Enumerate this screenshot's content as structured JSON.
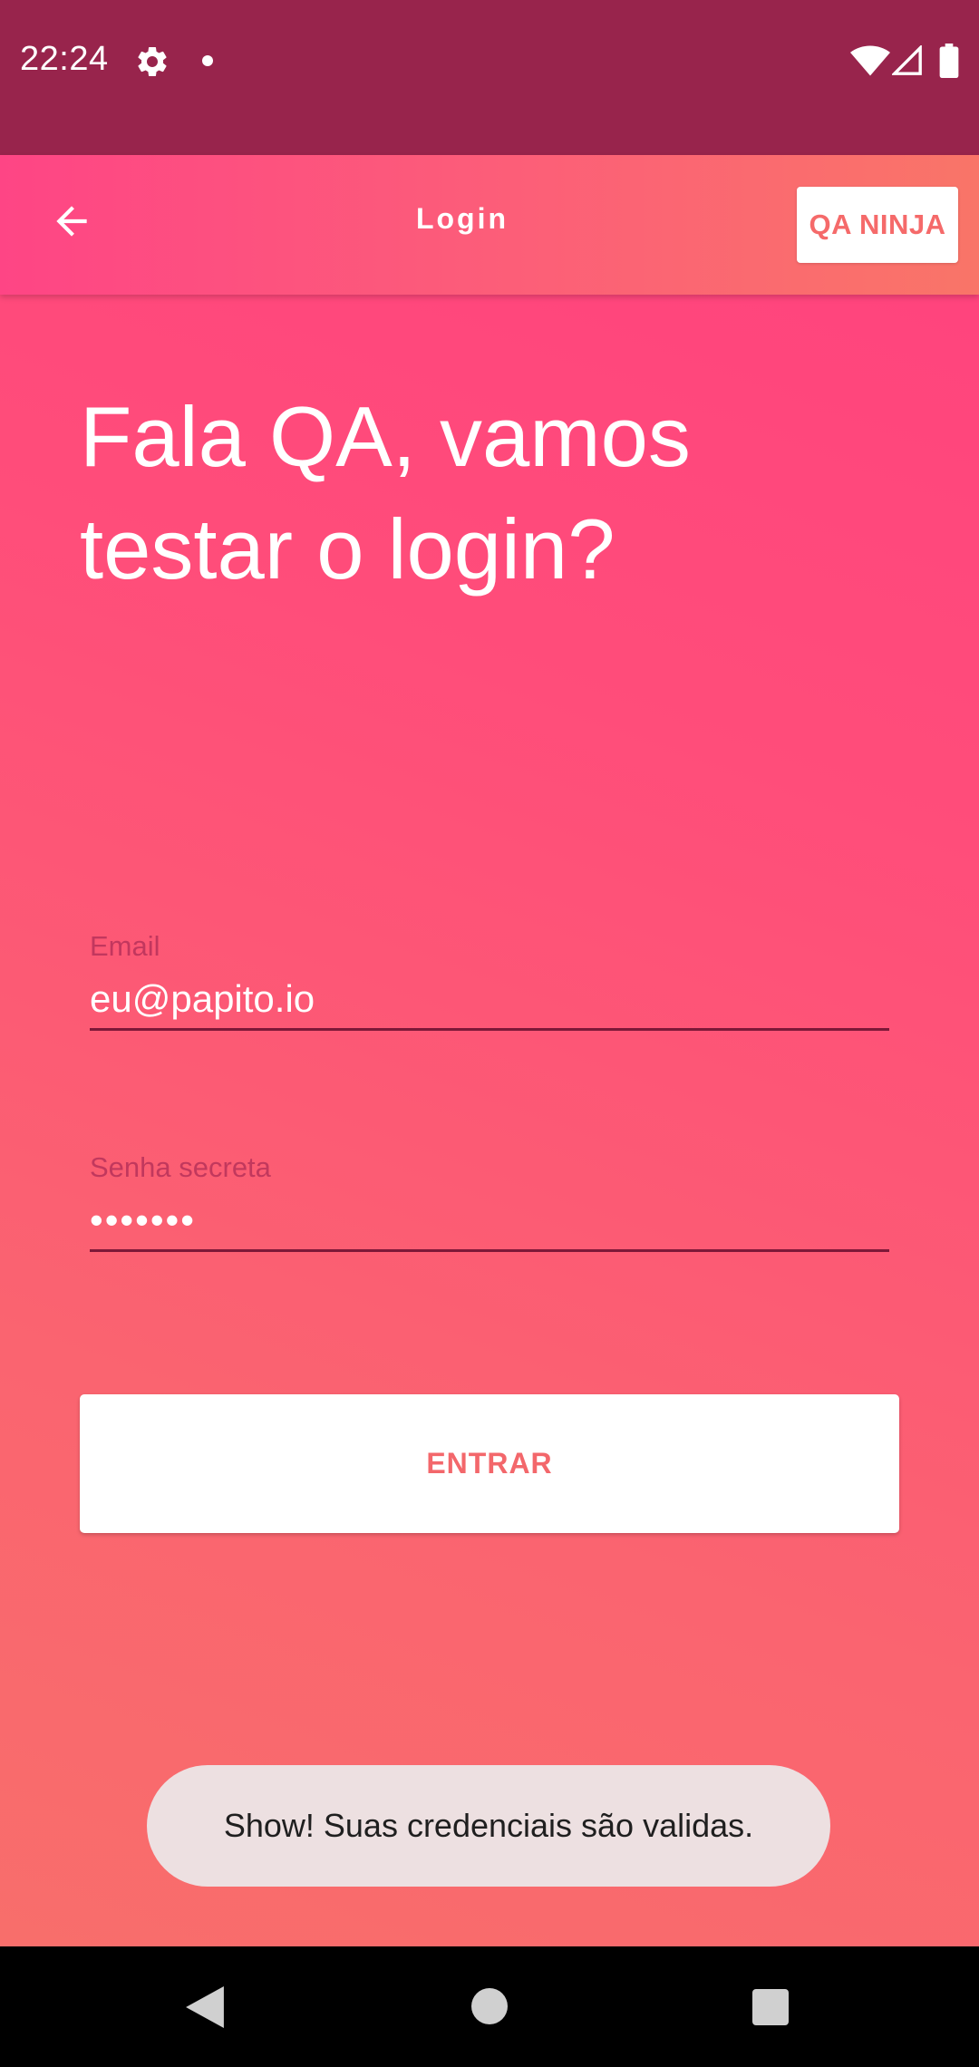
{
  "status_bar": {
    "time": "22:24",
    "icons": [
      "gear-icon",
      "notification-dot-icon",
      "wifi-icon",
      "signal-icon",
      "battery-icon"
    ]
  },
  "app_bar": {
    "back_icon": "arrow-left-icon",
    "title": "Login",
    "brand_button": "QA NINJA"
  },
  "heading": "Fala QA, vamos testar o login?",
  "form": {
    "email": {
      "label": "Email",
      "value": "eu@papito.io"
    },
    "password": {
      "label": "Senha secreta",
      "value": "•••••••"
    },
    "submit_label": "ENTRAR"
  },
  "toast": "Show! Suas credenciais são validas.",
  "nav_bar": {
    "icons": [
      "back-triangle-icon",
      "home-circle-icon",
      "recents-square-icon"
    ]
  },
  "colors": {
    "status_bar": "#98244c",
    "gradient_start": "#ff3f7f",
    "gradient_end": "#f8706a",
    "accent_text": "#f3676b",
    "toast_bg": "#ede0e1"
  }
}
